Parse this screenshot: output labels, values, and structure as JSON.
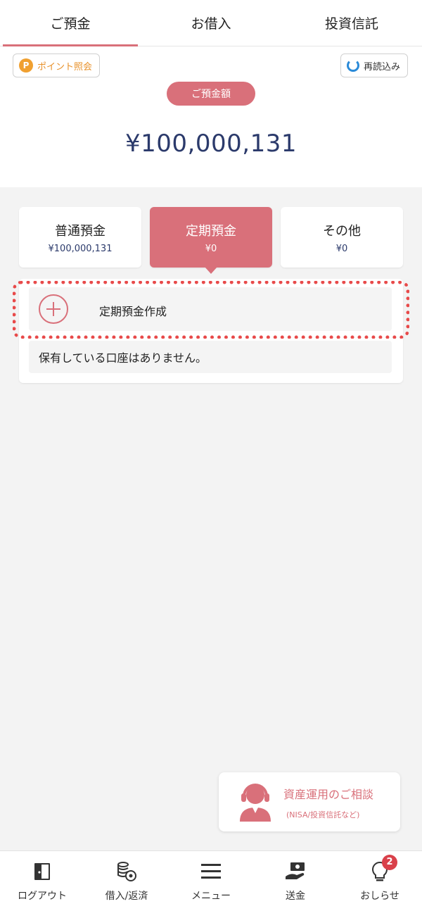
{
  "top_tabs": [
    {
      "label": "ご預金",
      "active": true
    },
    {
      "label": "お借入",
      "active": false
    },
    {
      "label": "投資信託",
      "active": false
    }
  ],
  "header": {
    "point_button_label": "ポイント照会",
    "point_icon_glyph": "P",
    "reload_button_label": "再読込み",
    "balance_badge": "ご預金額",
    "total_amount": "¥100,000,131"
  },
  "account_tabs": [
    {
      "name": "普通預金",
      "value": "¥100,000,131",
      "active": false
    },
    {
      "name": "定期預金",
      "value": "¥0",
      "active": true
    },
    {
      "name": "その他",
      "value": "¥0",
      "active": false
    }
  ],
  "time_deposit": {
    "create_label": "定期預金作成",
    "empty_message": "保有している口座はありません。"
  },
  "consult": {
    "title": "資産運用のご相談",
    "subtitle": "(NISA/投資信託など)"
  },
  "bottom_nav": [
    {
      "label": "ログアウト",
      "icon": "logout-icon"
    },
    {
      "label": "借入/返済",
      "icon": "coins-icon"
    },
    {
      "label": "メニュー",
      "icon": "menu-icon"
    },
    {
      "label": "送金",
      "icon": "transfer-icon"
    },
    {
      "label": "おしらせ",
      "icon": "bulb-icon",
      "badge": "2"
    }
  ],
  "colors": {
    "accent": "#d9707a",
    "amount": "#2b3a6b",
    "highlight": "#e84a4a",
    "point": "#f0a030",
    "reload": "#2a8ad8"
  }
}
